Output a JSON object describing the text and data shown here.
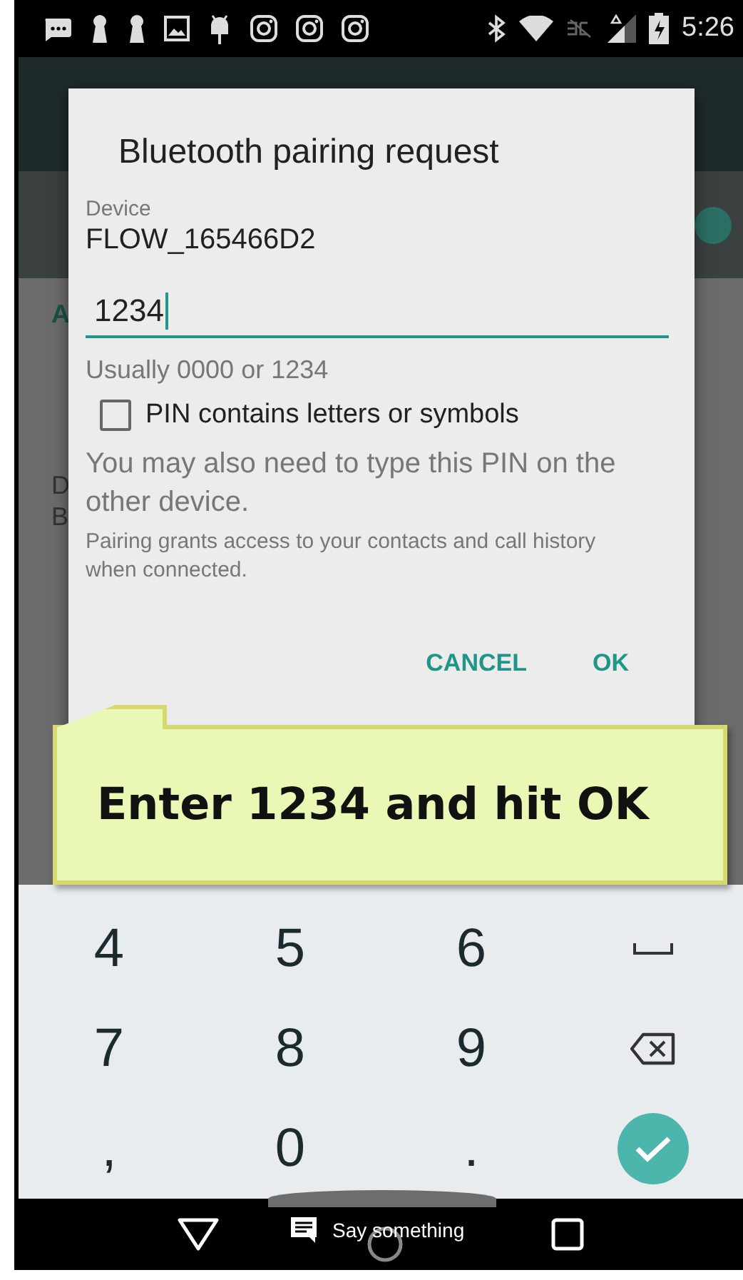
{
  "status_bar": {
    "time": "5:26"
  },
  "background": {
    "peek_texts": [
      {
        "text": "A",
        "kind": "accent"
      },
      {
        "text": "D",
        "kind": "plain"
      },
      {
        "text": "B",
        "kind": "plain"
      }
    ],
    "toggle": {
      "on": true
    }
  },
  "dialog": {
    "title": "Bluetooth pairing request",
    "device_label": "Device",
    "device_name": "FLOW_165466D2",
    "pin_field": {
      "value": "1234"
    },
    "hint": "Usually 0000 or 1234",
    "checkbox": {
      "label": "PIN contains letters or symbols",
      "checked": false
    },
    "message": "You may also need to type this PIN on the other device.",
    "note": "Pairing grants access to your contacts and call history when connected.",
    "buttons": [
      "CANCEL",
      "OK"
    ]
  },
  "callout": {
    "text": "Enter 1234 and hit OK"
  },
  "keyboard": {
    "keys": [
      {
        "kind": "char",
        "label": "4"
      },
      {
        "kind": "char",
        "label": "5"
      },
      {
        "kind": "char",
        "label": "6"
      },
      {
        "kind": "space"
      },
      {
        "kind": "char",
        "label": "7"
      },
      {
        "kind": "char",
        "label": "8"
      },
      {
        "kind": "char",
        "label": "9"
      },
      {
        "kind": "backspace"
      },
      {
        "kind": "char",
        "label": ","
      },
      {
        "kind": "char",
        "label": "0"
      },
      {
        "kind": "char",
        "label": "."
      },
      {
        "kind": "done"
      }
    ]
  },
  "toast": {
    "text": "Say something"
  }
}
